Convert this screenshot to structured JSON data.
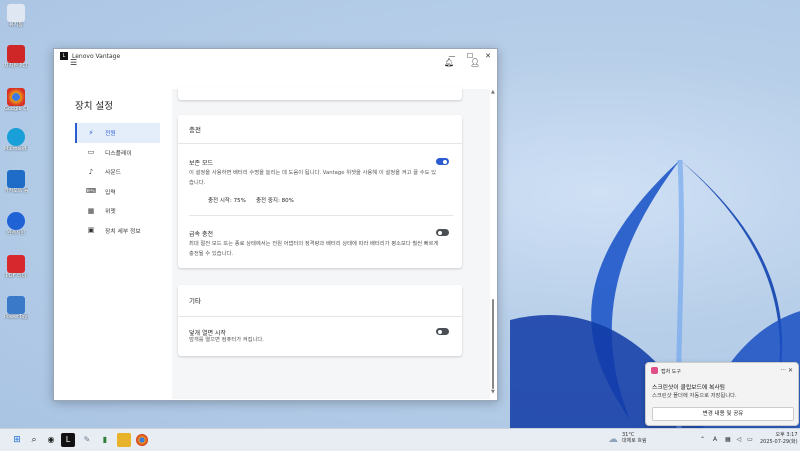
{
  "desktop": {
    "icons": [
      {
        "label": "휴지통",
        "color": "#dfe8f2"
      },
      {
        "label": "지지된 PC대행정보",
        "color": "#cf2727"
      },
      {
        "label": "Google Chrome",
        "color": "#e8a21a"
      },
      {
        "label": "Microsoft Edge",
        "color": "#1aa0d8"
      },
      {
        "label": "카카오톡 등",
        "color": "#1e6cc8"
      },
      {
        "label": "원격지원",
        "color": "#1f63d6"
      },
      {
        "label": "PDF 리더",
        "color": "#d6282d"
      },
      {
        "label": "PowerToys",
        "color": "#3a78c8"
      }
    ]
  },
  "window": {
    "title": "Lenovo Vantage",
    "logo_letter": "L",
    "controls": {
      "minimize": "—",
      "maximize": "☐",
      "close": "✕"
    }
  },
  "sidebar": {
    "title": "장치 설정",
    "items": [
      {
        "label": "전원",
        "icon": "⚡",
        "active": true
      },
      {
        "label": "디스플레이",
        "icon": "▭",
        "active": false
      },
      {
        "label": "사운드",
        "icon": "♪",
        "active": false
      },
      {
        "label": "입력",
        "icon": "⌨",
        "active": false
      },
      {
        "label": "위젯",
        "icon": "▦",
        "active": false
      },
      {
        "label": "장치 세부 정보",
        "icon": "▣",
        "active": false
      }
    ]
  },
  "charging": {
    "title": "충전",
    "conservation": {
      "label": "보존 모드",
      "enabled": true,
      "description": "이 설정을 사용하면 배터리 수명을 늘리는 데 도움이 됩니다. Vantage 위젯을 사용해 이 설정을 켜고 끌 수도 있습니다.",
      "start_label": "충전 시작: 75%",
      "stop_label": "충전 중지: 80%"
    },
    "rapid": {
      "label": "급속 충전",
      "enabled": false,
      "description": "최대 절전 모드 또는 종료 상태에서는 전원 어댑터의 정격량과 배터리 상태에 따라 배터리가 평소보다 훨씬 빠르게 충전될 수 있습니다."
    }
  },
  "other": {
    "title": "기타",
    "lid": {
      "label": "덮개 열면 시작",
      "enabled": false,
      "description": "덮개를 열으면 컴퓨터가 켜집니다."
    }
  },
  "toast": {
    "title": "캡처 도구",
    "ctrls": "··· ✕",
    "line1": "스크린샷이 클립보드에 복사됨",
    "line2": "스크린샷 폴더에 자동으로 저장됩니다.",
    "button": "변경 내용 및 공유"
  },
  "taskbar": {
    "weather_temp": "31°C",
    "weather_desc": "대체로 흐림",
    "lang": "A",
    "time": "오후 3:17",
    "date": "2025-07-29(화)"
  }
}
